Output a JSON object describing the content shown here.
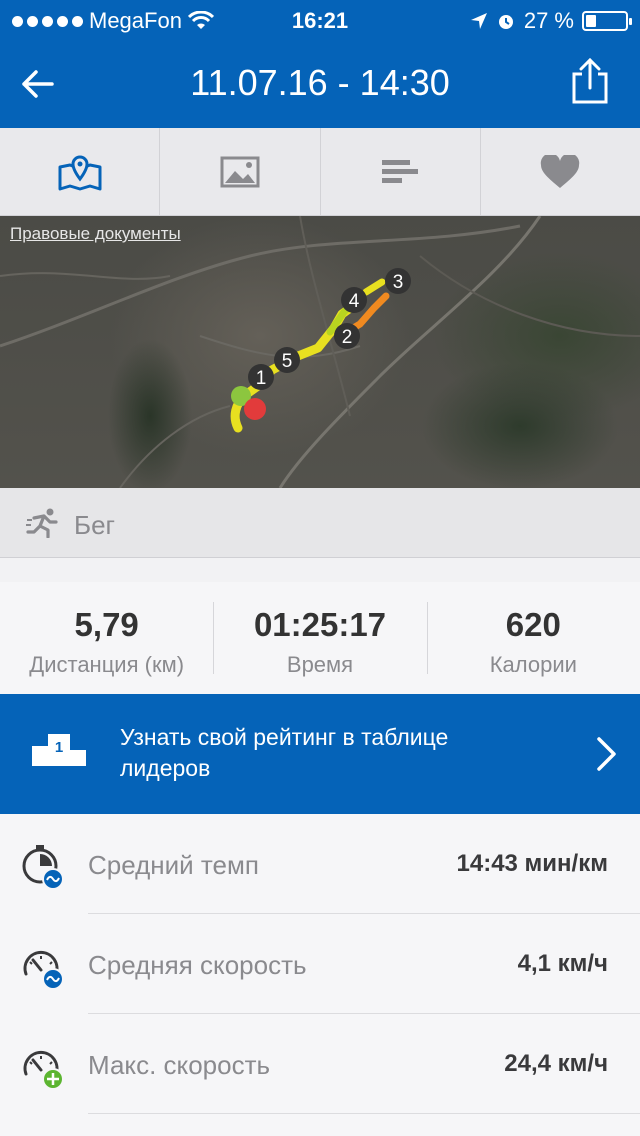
{
  "status_bar": {
    "carrier": "MegaFon",
    "time": "16:21",
    "battery_percent": "27 %",
    "battery_level": 0.27
  },
  "nav": {
    "title": "11.07.16 - 14:30"
  },
  "tabs": [
    {
      "icon": "map-icon",
      "active": true
    },
    {
      "icon": "image-icon",
      "active": false
    },
    {
      "icon": "bars-icon",
      "active": false
    },
    {
      "icon": "heart-icon",
      "active": false
    }
  ],
  "map": {
    "legal_link": "Правовые документы",
    "markers": [
      "1",
      "2",
      "3",
      "4",
      "5"
    ]
  },
  "activity": {
    "icon": "running-icon",
    "label": "Бег"
  },
  "stats": {
    "distance": {
      "value": "5,79",
      "label": "Дистанция (км)"
    },
    "time": {
      "value": "01:25:17",
      "label": "Время"
    },
    "calories": {
      "value": "620",
      "label": "Калории"
    }
  },
  "leaderboard": {
    "podium_number": "1",
    "text": "Узнать свой рейтинг в таблице лидеров"
  },
  "metrics": [
    {
      "icon": "stopwatch-icon",
      "name": "Средний темп",
      "value": "14:43 мин/км"
    },
    {
      "icon": "speedometer-icon",
      "name": "Средняя скорость",
      "value": "4,1 км/ч"
    },
    {
      "icon": "speedometer-plus-icon",
      "name": "Макс. скорость",
      "value": "24,4 км/ч"
    }
  ],
  "colors": {
    "brand_blue": "#0563b8",
    "route_yellow": "#e8e020",
    "route_orange": "#f08a20",
    "start_green": "#8cc63f",
    "end_red": "#e23b3b"
  }
}
